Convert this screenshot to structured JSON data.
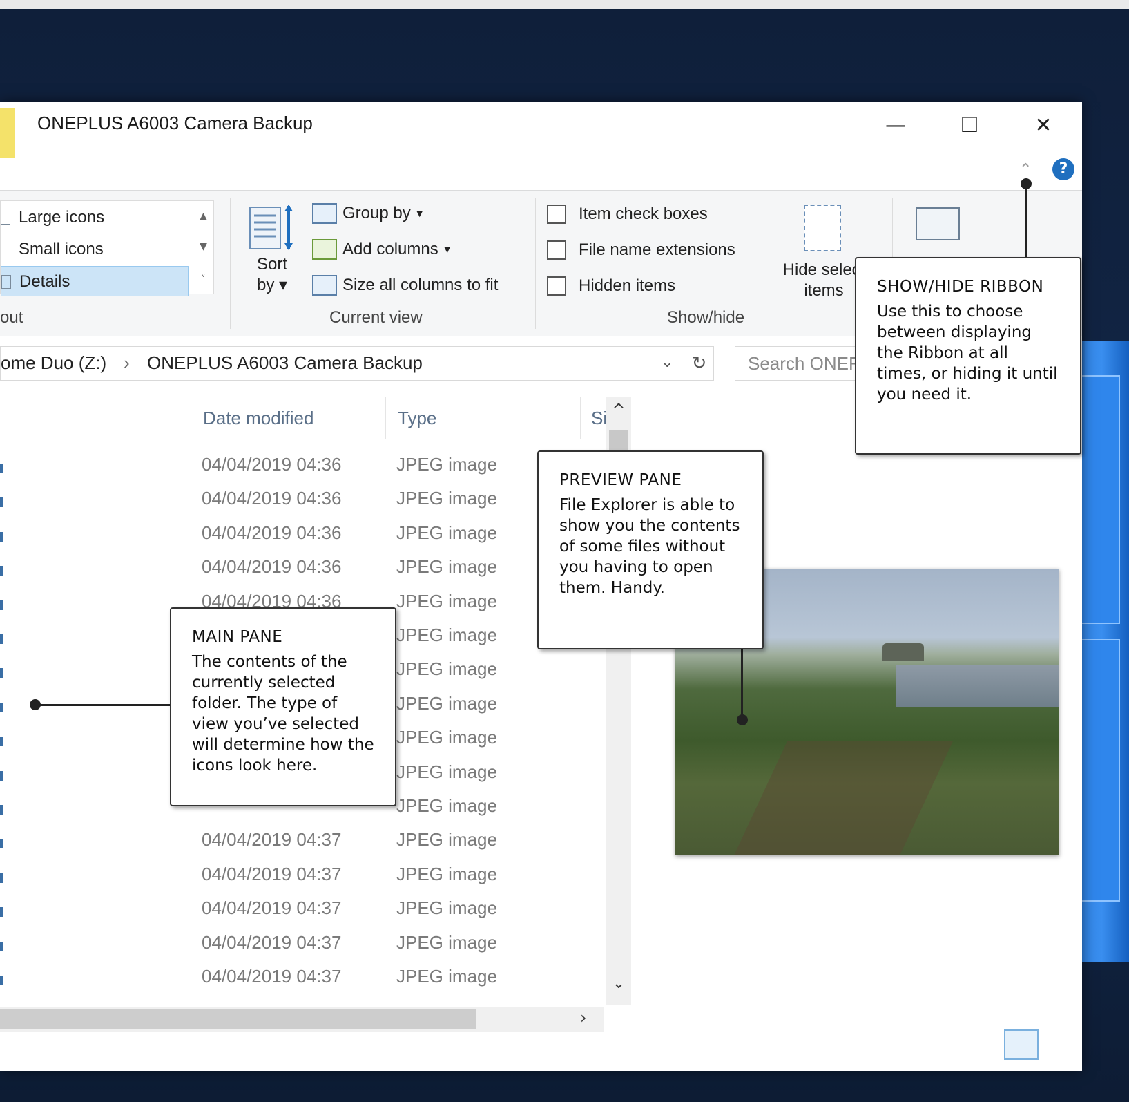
{
  "window": {
    "title": "ONEPLUS A6003 Camera Backup",
    "minimize_glyph": "—",
    "maximize_glyph": "☐",
    "close_glyph": "✕",
    "ribbon_toggle_glyph": "⌃",
    "help_glyph": "?"
  },
  "ribbon": {
    "layout": {
      "items": [
        "Large icons",
        "Small icons",
        "Details"
      ],
      "selected": "Details",
      "group_label": "out"
    },
    "current_view": {
      "sort_label_1": "Sort",
      "sort_label_2": "by ▾",
      "group_by": "Group by",
      "add_columns": "Add columns",
      "size_all": "Size all columns to fit",
      "group_label": "Current view"
    },
    "show_hide": {
      "item_check_boxes": "Item check boxes",
      "file_name_extensions": "File name extensions",
      "hidden_items": "Hidden items",
      "hide_selected_1": "Hide select",
      "hide_selected_2": "items",
      "group_label": "Show/hide"
    }
  },
  "address": {
    "segments": [
      "ome Duo (Z:)",
      "ONEPLUS A6003 Camera Backup"
    ],
    "separator": "›",
    "dropdown_glyph": "⌄",
    "refresh_glyph": "↻",
    "search_placeholder": "Search ONEF"
  },
  "columns": {
    "date_modified": "Date modified",
    "type": "Type",
    "size": "Si"
  },
  "rows": [
    {
      "date": "04/04/2019 04:36",
      "type": "JPEG image"
    },
    {
      "date": "04/04/2019 04:36",
      "type": "JPEG image"
    },
    {
      "date": "04/04/2019 04:36",
      "type": "JPEG image"
    },
    {
      "date": "04/04/2019 04:36",
      "type": "JPEG image"
    },
    {
      "date": "04/04/2019 04:36",
      "type": "JPEG image"
    },
    {
      "date": "",
      "type": "JPEG image"
    },
    {
      "date": "",
      "type": "JPEG image"
    },
    {
      "date": "",
      "type": "JPEG image"
    },
    {
      "date": "",
      "type": "JPEG image"
    },
    {
      "date": "",
      "type": "JPEG image"
    },
    {
      "date": "",
      "type": "JPEG image"
    },
    {
      "date": "04/04/2019 04:37",
      "type": "JPEG image"
    },
    {
      "date": "04/04/2019 04:37",
      "type": "JPEG image"
    },
    {
      "date": "04/04/2019 04:37",
      "type": "JPEG image"
    },
    {
      "date": "04/04/2019 04:37",
      "type": "JPEG image"
    },
    {
      "date": "04/04/2019 04:37",
      "type": "JPEG image"
    }
  ],
  "callouts": {
    "show_hide_ribbon": {
      "title": "SHOW/HIDE RIBBON",
      "body": "Use this to choose between displaying the Ribbon at all times, or hiding it until you need it."
    },
    "preview_pane": {
      "title": "PREVIEW PANE",
      "body": "File Explorer is able to show you the contents of some files without you having to open them. Handy."
    },
    "main_pane": {
      "title": "MAIN PANE",
      "body": "The contents of the currently selected folder. The type of view you’ve selected will determine how the icons look here."
    }
  },
  "scroll": {
    "up_glyph": "^",
    "down_glyph": "⌄",
    "right_glyph": "›"
  },
  "colors": {
    "accent": "#1f6fbf",
    "selection": "#cce4f7",
    "desktop": "#0f1f3a"
  }
}
